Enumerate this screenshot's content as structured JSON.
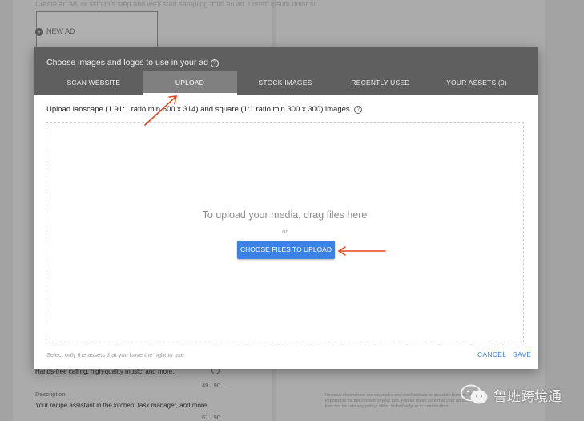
{
  "background": {
    "top_text": "Create an ad, or skip this step and we'll start sampling from an ad. Lorem ipsum dolor sit",
    "new_ad_label": "NEW AD",
    "description_line": "Hands-free calling, high-quality music, and more.",
    "count_1": "49 / 90",
    "description_label": "Description",
    "description_value": "Your recipe assistant in the kitchen, task manager, and more.",
    "count_2": "61 / 90",
    "right_note": "Previews shown here are examples and don't include all possible formats. You're responsible for the content of your ads. Please make sure that your ad content does not include any policy, either individually, or in combination."
  },
  "modal": {
    "title": "Choose images and logos to use in your ad",
    "tabs": [
      {
        "label": "SCAN WEBSITE",
        "active": false
      },
      {
        "label": "UPLOAD",
        "active": true
      },
      {
        "label": "STOCK IMAGES",
        "active": false
      },
      {
        "label": "RECENTLY USED",
        "active": false
      },
      {
        "label": "YOUR ASSETS (0)",
        "active": false
      }
    ],
    "instructions": "Upload lanscape (1.91:1 ratio min 600 x 314) and square (1:1 ratio min 300 x 300) images.",
    "dropzone": {
      "heading": "To upload your media, drag files here",
      "or": "or",
      "choose_button": "CHOOSE FILES TO UPLOAD"
    },
    "footer_note": "Select only the assets that you have the right to use",
    "cancel": "CANCEL",
    "save": "SAVE"
  },
  "icons": {
    "help": "help-circle-icon",
    "add": "plus-circle-icon",
    "watermark": "wechat-icon"
  },
  "colors": {
    "header_bg": "#5f5f5f",
    "active_tab_bg": "#808080",
    "primary_blue": "#3b82e6",
    "annotation_arrow": "#e8441a"
  },
  "watermark": {
    "text": "鲁班跨境通"
  }
}
